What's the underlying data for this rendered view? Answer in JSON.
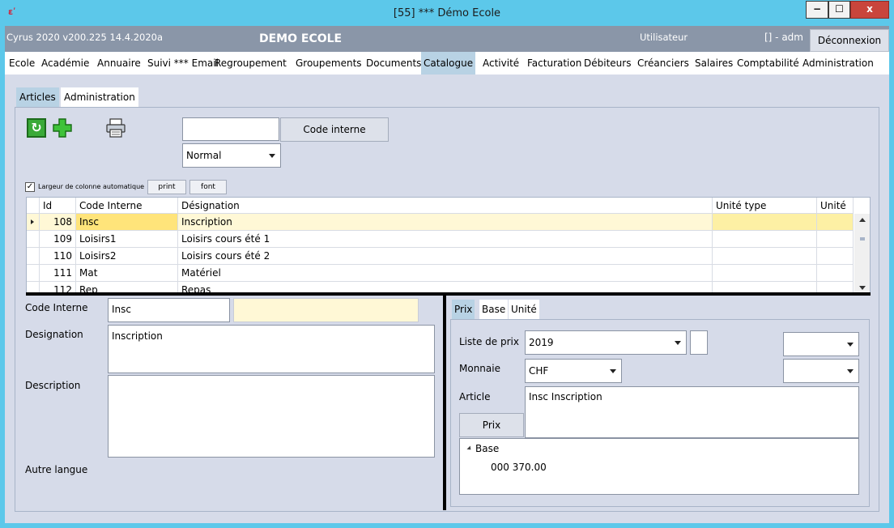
{
  "window": {
    "title": "[55] *** Démo Ecole",
    "minimize": "−",
    "maximize": "☐",
    "close": "x"
  },
  "header": {
    "version": "Cyrus 2020 v200.225 14.4.2020a",
    "school": "DEMO ECOLE",
    "user_label": "Utilisateur",
    "user_value": "[] - adm",
    "logout": "Déconnexion"
  },
  "menu": [
    {
      "label": "Ecole"
    },
    {
      "label": "Académie"
    },
    {
      "label": "Annuaire"
    },
    {
      "label": "Suivi *** Email"
    },
    {
      "label": "Regroupement"
    },
    {
      "label": "Groupements"
    },
    {
      "label": "Documents"
    },
    {
      "label": "Catalogue"
    },
    {
      "label": "Activité"
    },
    {
      "label": "Facturation"
    },
    {
      "label": "Débiteurs"
    },
    {
      "label": "Créanciers"
    },
    {
      "label": "Salaires"
    },
    {
      "label": "Comptabilité"
    },
    {
      "label": "Administration"
    }
  ],
  "subtabs": {
    "articles": "Articles",
    "administration": "Administration"
  },
  "toolbar": {
    "search_value": "",
    "code_interne_button": "Code interne",
    "mode_value": "Normal",
    "autocol_label": "Largeur de colonne automatique",
    "autocol_checked": "✓",
    "print_button": "print",
    "font_button": "font"
  },
  "grid": {
    "columns": [
      "Id",
      "Code Interne",
      "Désignation",
      "Unité type",
      "Unité"
    ],
    "rows": [
      {
        "id": "108",
        "code": "Insc",
        "designation": "Inscription",
        "unite_type": "",
        "unite": ""
      },
      {
        "id": "109",
        "code": "Loisirs1",
        "designation": "Loisirs cours été 1",
        "unite_type": "",
        "unite": ""
      },
      {
        "id": "110",
        "code": "Loisirs2",
        "designation": "Loisirs cours été 2",
        "unite_type": "",
        "unite": ""
      },
      {
        "id": "111",
        "code": "Mat",
        "designation": "Matériel",
        "unite_type": "",
        "unite": ""
      },
      {
        "id": "112",
        "code": "Rep",
        "designation": "Repas",
        "unite_type": "",
        "unite": ""
      }
    ]
  },
  "detail": {
    "code_label": "Code Interne",
    "code_value": "Insc",
    "designation_label": "Designation",
    "designation_value": "Inscription",
    "description_label": "Description",
    "description_value": "",
    "autre_langue_label": "Autre langue"
  },
  "price_panel": {
    "tabs": {
      "prix": "Prix",
      "base": "Base",
      "unite": "Unité"
    },
    "liste_prix_label": "Liste de prix",
    "liste_prix_value": "2019",
    "monnaie_label": "Monnaie",
    "monnaie_value": "CHF",
    "article_label": "Article",
    "article_value": "Insc  Inscription",
    "prix_button": "Prix",
    "tree_root": "Base",
    "tree_value": "000 370.00"
  },
  "colors": {
    "titlebar": "#5cc8ea",
    "header": "#8a96a8",
    "client": "#d6dbe9",
    "active_tab": "#b8d2e4",
    "selected_row": "#fff8d6"
  }
}
